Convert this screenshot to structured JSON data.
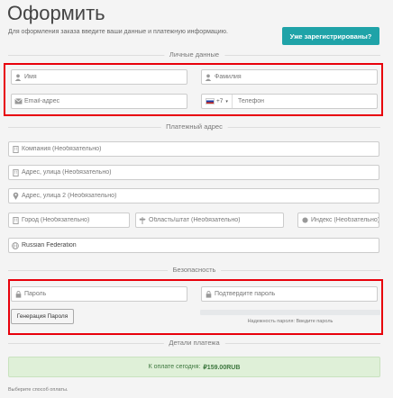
{
  "page": {
    "title": "Оформить",
    "intro": "Для оформления заказа введите ваши данные и платежную информацию.",
    "login_button": "Уже зарегистрированы?"
  },
  "personal": {
    "heading": "Личные данные",
    "first_name": "Имя",
    "last_name": "Фамилия",
    "email": "Email-адрес",
    "phone_code": "+7",
    "phone": "Телефон"
  },
  "billing": {
    "heading": "Платежный адрес",
    "company": "Компания (Необязательно)",
    "address1": "Адрес, улица (Необязательно)",
    "address2": "Адрес, улица 2 (Необязательно)",
    "city": "Город (Необязательно)",
    "state": "Область/штат (Необязательно)",
    "postcode": "Индекс (Необзательно)",
    "country": "Russian Federation"
  },
  "security": {
    "heading": "Безопасность",
    "password": "Пароль",
    "confirm_password": "Подтвердите пароль",
    "generate_button": "Генерация Пароля",
    "strength_text": "Надежность пароля: Введите пароль"
  },
  "payment": {
    "heading": "Детали платежа",
    "due_label": "К оплате сегодня:",
    "due_amount": "₽159.00RUB",
    "choose_method": "Выберите способ оплаты."
  },
  "icons": {
    "user": "user-icon",
    "email": "envelope-icon",
    "building": "building-icon",
    "map_marker": "map-marker-icon",
    "globe": "globe-icon",
    "lock": "lock-icon"
  },
  "colors": {
    "accent": "#1fa3a8",
    "highlight": "#e8000b",
    "success_bg": "#dff0d8"
  }
}
